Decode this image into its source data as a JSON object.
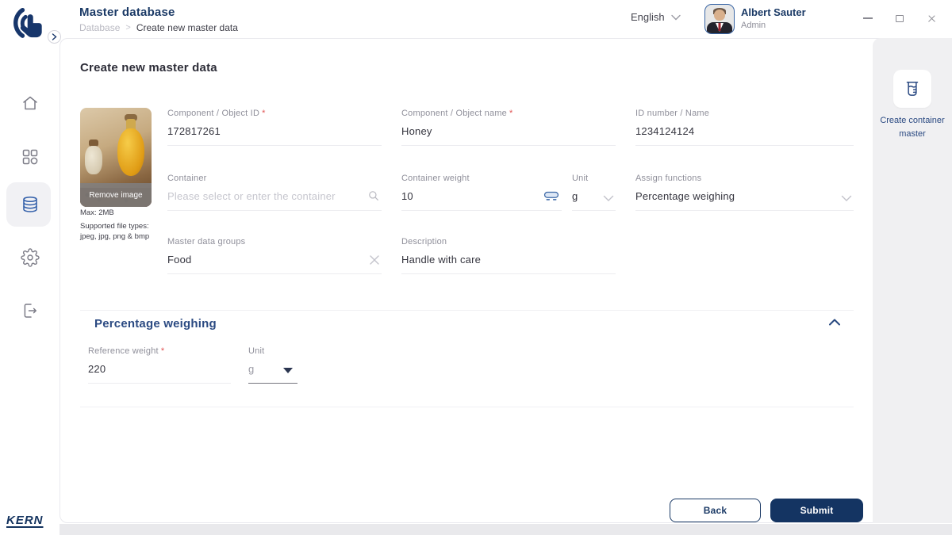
{
  "header": {
    "app_title": "Master database",
    "breadcrumb_parent": "Database",
    "breadcrumb_sep": ">",
    "breadcrumb_current": "Create new master data",
    "language": "English",
    "user_name": "Albert Sauter",
    "user_role": "Admin"
  },
  "sidebar": {
    "brand": "KERN"
  },
  "form": {
    "title": "Create new master data",
    "required_mark": "*",
    "image": {
      "remove_label": "Remove image",
      "max_note": "Max: 2MB",
      "types_note_1": "Supported file types:",
      "types_note_2": "jpeg, jpg, png & bmp"
    },
    "component_id_label": "Component / Object ID",
    "component_id_value": "172817261",
    "component_name_label": "Component / Object name",
    "component_name_value": "Honey",
    "id_number_label": "ID number / Name",
    "id_number_value": "1234124124",
    "container_label": "Container",
    "container_placeholder": "Please select or enter the container",
    "container_weight_label": "Container weight",
    "container_weight_value": "10",
    "unit_label": "Unit",
    "unit_value": "g",
    "assign_functions_label": "Assign functions",
    "assign_functions_value": "Percentage weighing",
    "groups_label": "Master data groups",
    "groups_value": "Food",
    "description_label": "Description",
    "description_value": "Handle with care"
  },
  "section": {
    "title": "Percentage weighing",
    "reference_weight_label": "Reference weight",
    "reference_weight_value": "220",
    "unit_label": "Unit",
    "unit_value": "g"
  },
  "actions": {
    "back": "Back",
    "submit": "Submit"
  },
  "right_panel": {
    "create_container_label": "Create container master"
  },
  "colors": {
    "primary": "#17366b",
    "accent_blue": "#2f5da8",
    "required": "#e05252",
    "panel_bg": "#f0f0f2"
  }
}
